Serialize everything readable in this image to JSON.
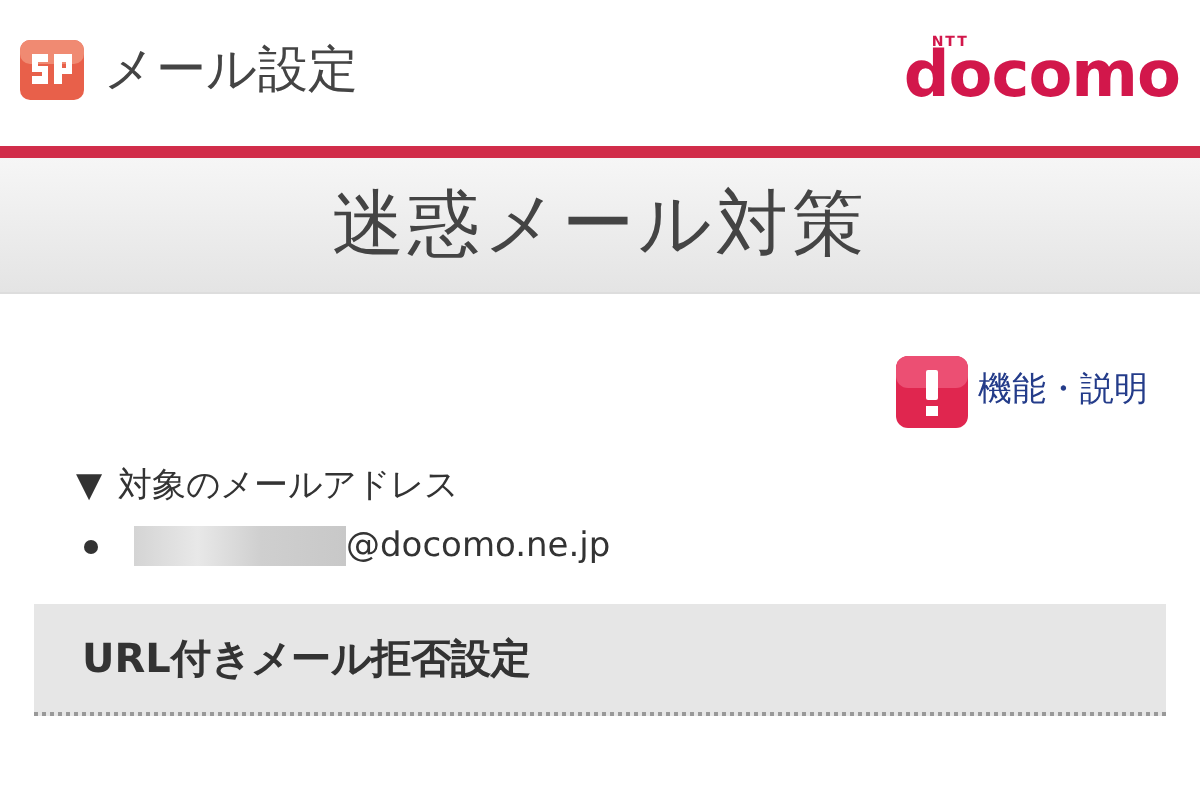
{
  "header": {
    "app_title": "メール設定",
    "brand_small": "NTT",
    "brand": "docomo"
  },
  "page_title": "迷惑メール対策",
  "help_link": {
    "label": "機能・説明"
  },
  "address_section": {
    "toggle": "▼",
    "label": "対象のメールアドレス",
    "expanded": true,
    "addresses": [
      {
        "redacted": true,
        "domain": "@docomo.ne.jp"
      }
    ]
  },
  "sections": [
    {
      "title": "URL付きメール拒否設定"
    }
  ]
}
